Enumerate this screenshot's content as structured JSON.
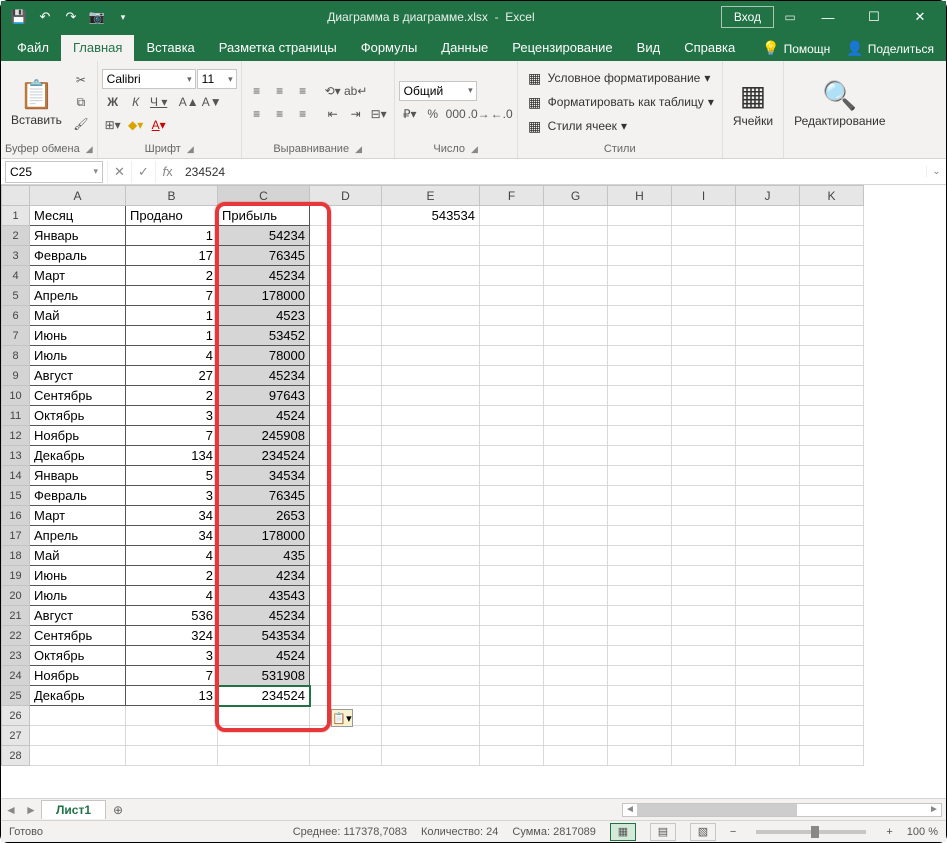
{
  "titlebar": {
    "filename": "Диаграмма в диаграмме.xlsx",
    "appname": "Excel",
    "signin": "Вход"
  },
  "tabs": {
    "file": "Файл",
    "home": "Главная",
    "insert": "Вставка",
    "layout": "Разметка страницы",
    "formulas": "Формулы",
    "data": "Данные",
    "review": "Рецензирование",
    "view": "Вид",
    "help": "Справка",
    "tellme": "Помощн",
    "share": "Поделиться"
  },
  "ribbon": {
    "clipboard": {
      "paste": "Вставить",
      "label": "Буфер обмена"
    },
    "font": {
      "name": "Calibri",
      "size": "11",
      "label": "Шрифт"
    },
    "alignment": {
      "label": "Выравнивание"
    },
    "number": {
      "format": "Общий",
      "label": "Число"
    },
    "styles": {
      "condfmt": "Условное форматирование",
      "fmttable": "Форматировать как таблицу",
      "cellstyles": "Стили ячеек",
      "label": "Стили"
    },
    "cells": {
      "label": "Ячейки"
    },
    "editing": {
      "label": "Редактирование"
    }
  },
  "fbar": {
    "name": "C25",
    "formula": "234524"
  },
  "columns": [
    "A",
    "B",
    "C",
    "D",
    "E",
    "F",
    "G",
    "H",
    "I",
    "J",
    "K"
  ],
  "headers": {
    "a": "Месяц",
    "b": "Продано",
    "c": "Прибыль"
  },
  "e1": "543534",
  "rows": [
    {
      "n": 1
    },
    {
      "n": 2,
      "a": "Январь",
      "b": "1",
      "c": "54234"
    },
    {
      "n": 3,
      "a": "Февраль",
      "b": "17",
      "c": "76345"
    },
    {
      "n": 4,
      "a": "Март",
      "b": "2",
      "c": "45234"
    },
    {
      "n": 5,
      "a": "Апрель",
      "b": "7",
      "c": "178000"
    },
    {
      "n": 6,
      "a": "Май",
      "b": "1",
      "c": "4523"
    },
    {
      "n": 7,
      "a": "Июнь",
      "b": "1",
      "c": "53452"
    },
    {
      "n": 8,
      "a": "Июль",
      "b": "4",
      "c": "78000"
    },
    {
      "n": 9,
      "a": "Август",
      "b": "27",
      "c": "45234"
    },
    {
      "n": 10,
      "a": "Сентябрь",
      "b": "2",
      "c": "97643"
    },
    {
      "n": 11,
      "a": "Октябрь",
      "b": "3",
      "c": "4524"
    },
    {
      "n": 12,
      "a": "Ноябрь",
      "b": "7",
      "c": "245908"
    },
    {
      "n": 13,
      "a": "Декабрь",
      "b": "134",
      "c": "234524"
    },
    {
      "n": 14,
      "a": "Январь",
      "b": "5",
      "c": "34534"
    },
    {
      "n": 15,
      "a": "Февраль",
      "b": "3",
      "c": "76345"
    },
    {
      "n": 16,
      "a": "Март",
      "b": "34",
      "c": "2653"
    },
    {
      "n": 17,
      "a": "Апрель",
      "b": "34",
      "c": "178000"
    },
    {
      "n": 18,
      "a": "Май",
      "b": "4",
      "c": "435"
    },
    {
      "n": 19,
      "a": "Июнь",
      "b": "2",
      "c": "4234"
    },
    {
      "n": 20,
      "a": "Июль",
      "b": "4",
      "c": "43543"
    },
    {
      "n": 21,
      "a": "Август",
      "b": "536",
      "c": "45234"
    },
    {
      "n": 22,
      "a": "Сентябрь",
      "b": "324",
      "c": "543534"
    },
    {
      "n": 23,
      "a": "Октябрь",
      "b": "3",
      "c": "4524"
    },
    {
      "n": 24,
      "a": "Ноябрь",
      "b": "7",
      "c": "531908"
    },
    {
      "n": 25,
      "a": "Декабрь",
      "b": "13",
      "c": "234524"
    }
  ],
  "sheet": {
    "tab1": "Лист1"
  },
  "status": {
    "ready": "Готово",
    "avg_label": "Среднее:",
    "avg_val": "117378,7083",
    "count_label": "Количество:",
    "count_val": "24",
    "sum_label": "Сумма:",
    "sum_val": "2817089",
    "zoom": "100 %"
  }
}
